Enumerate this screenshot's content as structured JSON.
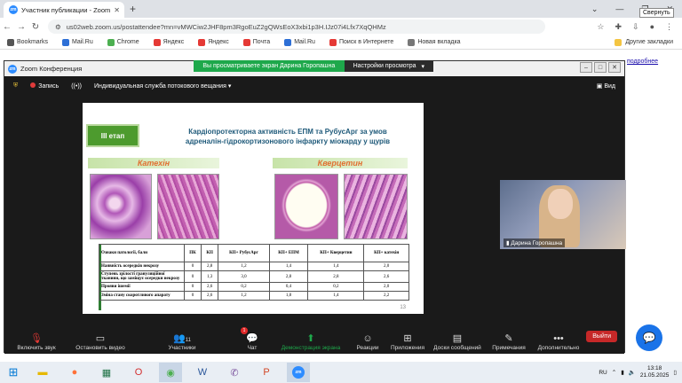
{
  "browser": {
    "tab_title": "Участник публикации - Zoom",
    "tab_icon": "zm",
    "url": "us02web.zoom.us/postattendee?mn=vMWCiw2JHF8pm3RgoEuZ2gQWsEoX3xbi1p3H.IJz07i4Lfx7XqQHMz",
    "tooltip": "Свернуть",
    "bookmarks": [
      {
        "label": "Bookmarks",
        "color": "#555"
      },
      {
        "label": "Mail.Ru",
        "color": "#2d6fd6"
      },
      {
        "label": "Chrome",
        "color": "#4caf50"
      },
      {
        "label": "Яндекс",
        "color": "#e53935"
      },
      {
        "label": "Яндекс",
        "color": "#e53935"
      },
      {
        "label": "Почта",
        "color": "#e53935"
      },
      {
        "label": "Mail.Ru",
        "color": "#2d6fd6"
      },
      {
        "label": "Поиск в Интернете",
        "color": "#e53935"
      },
      {
        "label": "Новая вкладка",
        "color": "#777"
      }
    ],
    "other_bookmarks": "Другие закладки",
    "page_link": "подробнее"
  },
  "zoom": {
    "window_title": "Zoom Конференция",
    "banner_text": "Вы просматриваете экран Дарина Горопашна",
    "view_options": "Настройки просмотра",
    "record_label": "Запись",
    "stream_label": "Индивидуальная служба потокового вещания",
    "view_label": "Вид",
    "participant_name": "Дарина Горопашна",
    "participants_count": "11",
    "chat_badge": "1",
    "toolbar": {
      "mute": "Включить звук",
      "video": "Остановить видео",
      "participants": "Участники",
      "chat": "Чат",
      "share": "Демонстрация экрана",
      "reactions": "Реакции",
      "apps": "Приложения",
      "whiteboards": "Доски сообщений",
      "notes": "Примечания",
      "more": "Дополнительно"
    },
    "leave": "Выйти"
  },
  "slide": {
    "stage": "ІІІ етап",
    "title_line1": "Кардіопротекторна активність ЕПМ та РубусАрг за умов",
    "title_line2": "адреналін-гідрокортизонового інфаркту міокарду у щурів",
    "left_header": "Катехін",
    "right_header": "Кверцетин",
    "page_number": "13",
    "table": {
      "headers": [
        "Ознаки патології, бали",
        "ПК",
        "КП",
        "КП+ РубусАрг",
        "КП+ ЕПМ",
        "КП+ Кверцетин",
        "КП+ катехін"
      ],
      "rows": [
        [
          "Наявність осередків некрозу",
          "0",
          "2,8",
          "1,2",
          "1,4",
          "1,4",
          "2,0"
        ],
        [
          "Ступень зрілості грануляційної тканини, що заміщує осередки некрозу",
          "0",
          "1,3",
          "3,0",
          "2,8",
          "2,8",
          "2,6"
        ],
        [
          "Прояви ішемії",
          "0",
          "2,6",
          "0,2",
          "0,4",
          "0,2",
          "2,0"
        ],
        [
          "Зміна стану скоротливого апарату",
          "0",
          "2,6",
          "1,2",
          "1,8",
          "1,4",
          "2,2"
        ]
      ]
    }
  },
  "taskbar": {
    "lang": "RU",
    "time": "13:18",
    "date": "21.05.2025"
  }
}
